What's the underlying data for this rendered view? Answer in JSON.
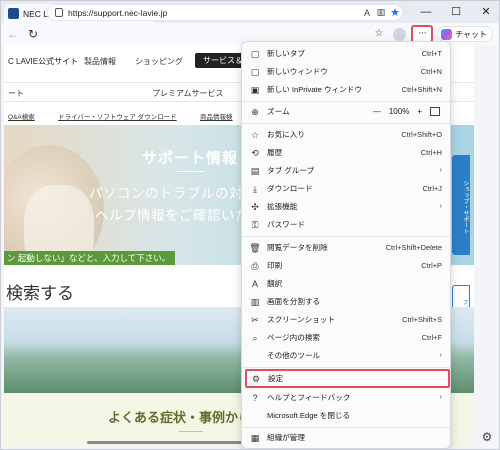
{
  "browser": {
    "tab_title": "NEC LAVIE公式サイト > サービス&サ",
    "tab_close": "✕",
    "new_tab": "+",
    "win_min": "—",
    "win_max": "☐",
    "win_close": "✕",
    "url": "https://support.nec-lavie.jp",
    "more_label": "···",
    "chat_label": "チャット"
  },
  "page": {
    "logo": "C LAVIE公式サイト",
    "nav": [
      "製品情報",
      "ショッピング",
      "サービス＆"
    ],
    "subnav": [
      "ート",
      "プレミアムサービス"
    ],
    "links": [
      "Q&A検索",
      "ドライバー・ソフトウェア ダウンロード",
      "商品情報検"
    ],
    "hero_title": "サポート情報",
    "hero_line1": "パソコンのトラブルの対処方法や",
    "hero_line2": "ヘルプ情報をご確認いただ",
    "hero_hint": "ン 起動しない」などと、入力して下さい。",
    "search_heading": "検索する",
    "faq_title": "よくある症状・事例から",
    "side_tab1": "ショップ・サポート",
    "side_tab2": "フィードバック"
  },
  "menu": {
    "items": [
      {
        "icon": "▢",
        "label": "新しいタブ",
        "shortcut": "Ctrl+T"
      },
      {
        "icon": "▢",
        "label": "新しいウィンドウ",
        "shortcut": "Ctrl+N"
      },
      {
        "icon": "▣",
        "label": "新しい InPrivate ウィンドウ",
        "shortcut": "Ctrl+Shift+N"
      },
      {
        "icon": "⊕",
        "label": "ズーム",
        "zoom_minus": "—",
        "zoom_value": "100%",
        "zoom_plus": "+"
      },
      {
        "icon": "☆",
        "label": "お気に入り",
        "shortcut": "Ctrl+Shift+O"
      },
      {
        "icon": "⟲",
        "label": "履歴",
        "shortcut": "Ctrl+H"
      },
      {
        "icon": "▤",
        "label": "タブ グループ",
        "arrow": "›"
      },
      {
        "icon": "⤓",
        "label": "ダウンロード",
        "shortcut": "Ctrl+J"
      },
      {
        "icon": "✣",
        "label": "拡張機能",
        "arrow": "›"
      },
      {
        "icon": "⚿",
        "label": "パスワード"
      },
      {
        "icon": "🗑",
        "label": "閲覧データを削除",
        "shortcut": "Ctrl+Shift+Delete"
      },
      {
        "icon": "⎙",
        "label": "印刷",
        "shortcut": "Ctrl+P"
      },
      {
        "icon": "A",
        "label": "翻訳"
      },
      {
        "icon": "▥",
        "label": "画面を分割する"
      },
      {
        "icon": "✂",
        "label": "スクリーンショット",
        "shortcut": "Ctrl+Shift+S"
      },
      {
        "icon": "⌕",
        "label": "ページ内の検索",
        "shortcut": "Ctrl+F"
      },
      {
        "icon": "",
        "label": "その他のツール",
        "arrow": "›"
      },
      {
        "icon": "⚙",
        "label": "設定"
      },
      {
        "icon": "?",
        "label": "ヘルプとフィードバック",
        "arrow": "›"
      },
      {
        "icon": "",
        "label": "Microsoft Edge を閉じる"
      },
      {
        "icon": "▦",
        "label": "組織が管理"
      }
    ]
  },
  "colors": {
    "highlight": "#e34b67",
    "accent": "#1a73e8"
  }
}
